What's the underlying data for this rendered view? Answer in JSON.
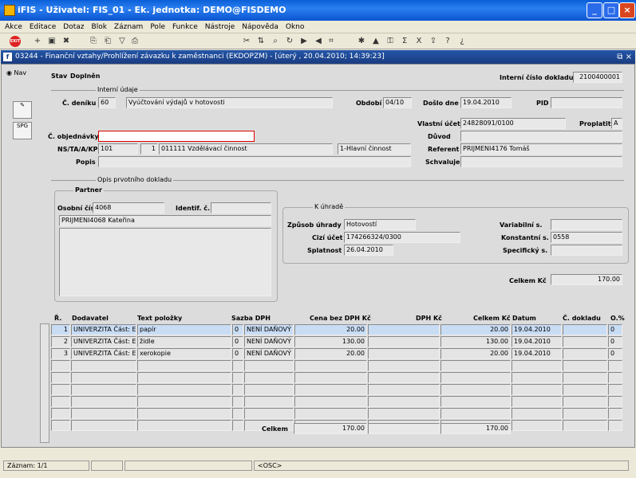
{
  "window": {
    "title": "iFIS - Uživatel: FIS_01 - Ek. jednotka: DEMO@FISDEMO"
  },
  "menu": [
    "Akce",
    "Editace",
    "Dotaz",
    "Blok",
    "Záznam",
    "Pole",
    "Funkce",
    "Nástroje",
    "Nápověda",
    "Okno"
  ],
  "toolbar": {
    "exit_label": "EXIT",
    "icons": [
      "add-record-icon",
      "save-icon",
      "delete-icon",
      "copy-icon",
      "paste-icon",
      "filter-icon",
      "print-icon",
      "cut-icon",
      "sort-icon",
      "find-icon",
      "refresh-icon",
      "next-icon",
      "previous-icon",
      "attach-icon",
      "tools-icon",
      "chart-icon",
      "lock-icon",
      "sum-icon",
      "excel-icon",
      "export-icon",
      "help-icon",
      "whatsthis-icon"
    ]
  },
  "form": {
    "title": "03244 - Finanční vztahy/Prohlížení závazku k zaměstnanci (EKDOPZM) - [úterý , 20.04.2010; 14:39:23]",
    "nav_label": "Nav",
    "stav_label": "Stav",
    "stav_value": "Doplněn",
    "icd_label": "Interní číslo dokladu",
    "icd_value": "2100400001",
    "interni_udaje": "Interní údaje",
    "cdeniku_label": "Č. deníku",
    "cdeniku_code": "60",
    "cdeniku_text": "Vyúčtování výdajů v hotovosti",
    "obdobi_label": "Období",
    "obdobi_value": "04/10",
    "doslo_label": "Došlo dne",
    "doslo_value": "19.04.2010",
    "pid_label": "PID",
    "pid_value": "",
    "vlastni_ucet_label": "Vlastní účet",
    "vlastni_ucet_value": "24828091/0100",
    "proplatit_label": "Proplatit",
    "proplatit_value": "A",
    "cobj_label": "Č. objednávky",
    "cobj_value": "",
    "duvod_label": "Důvod",
    "duvod_value": "",
    "ns_label": "NS/TA/A/KP",
    "ns1": "101",
    "ns2": "1",
    "ns3": "011111 Vzdělávací činnost",
    "ns4": "1-Hlavní činnost",
    "referent_label": "Referent",
    "referent_value": "PRIJMENI4176 Tomáš",
    "popis_label": "Popis",
    "popis_value": "",
    "schvaluje_label": "Schvaluje",
    "schvaluje_value": "",
    "opis_label": "Opis prvotního dokladu",
    "partner_label": "Partner",
    "osobni_label": "Osobní číslo",
    "osobni_value": "4068",
    "identif_label": "Identif. č.",
    "identif_value": "",
    "partner_name": "PRIJMENI4068 Kateřina",
    "k_uhrade": "K úhradě",
    "zpusob_label": "Způsob úhrady",
    "zpusob_value": "Hotovostí",
    "cizi_label": "Cizí účet",
    "cizi_value": "174266324/0300",
    "splatnost_label": "Splatnost",
    "splatnost_value": "26.04.2010",
    "variabilni_label": "Variabilní s.",
    "variabilni_value": "",
    "konstantni_label": "Konstantní s.",
    "konstantni_value": "0558",
    "specificky_label": "Specifický s.",
    "specificky_value": "",
    "celkem_kc_label": "Celkem Kč",
    "celkem_kc_value": "170.00"
  },
  "table": {
    "headers": [
      "Ř.",
      "Dodavatel",
      "Text položky",
      "Sazba DPH",
      "Cena bez DPH Kč",
      "DPH Kč",
      "Celkem Kč",
      "Datum",
      "Č. dokladu",
      "O.%"
    ],
    "rows": [
      {
        "r": "1",
        "dod": "UNIVERZITA Část: Ek",
        "text": "papír",
        "s1": "0",
        "s2": "NENÍ DAŇOVÝ D",
        "cena": "20.00",
        "dph": "",
        "celk": "20.00",
        "datum": "19.04.2010",
        "cdok": "",
        "o": "0"
      },
      {
        "r": "2",
        "dod": "UNIVERZITA Část: Ek",
        "text": "židle",
        "s1": "0",
        "s2": "NENÍ DAŇOVÝ D",
        "cena": "130.00",
        "dph": "",
        "celk": "130.00",
        "datum": "19.04.2010",
        "cdok": "",
        "o": "0"
      },
      {
        "r": "3",
        "dod": "UNIVERZITA Část: Ek",
        "text": "xerokopie",
        "s1": "0",
        "s2": "NENÍ DAŇOVÝ D",
        "cena": "20.00",
        "dph": "",
        "celk": "20.00",
        "datum": "19.04.2010",
        "cdok": "",
        "o": "0"
      }
    ],
    "empty_rows": 6,
    "total_label": "Celkem",
    "total_cena": "170.00",
    "total_dph": "",
    "total_celk": "170.00"
  },
  "status": {
    "zaznam": "Záznam: 1/1",
    "mode": "<OSC>"
  }
}
